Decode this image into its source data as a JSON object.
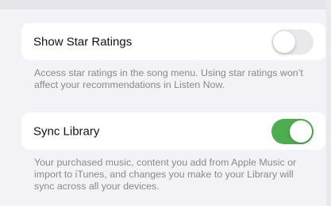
{
  "settings": {
    "star_ratings": {
      "label": "Show Star Ratings",
      "enabled": false,
      "footer": "Access star ratings in the song menu. Using star ratings won’t affect your recommendations in Listen Now."
    },
    "sync_library": {
      "label": "Sync Library",
      "enabled": true,
      "footer": "Your purchased music, content you add from Apple Music or import to iTunes, and changes you make to your Library will sync across all your devices."
    }
  },
  "colors": {
    "toggle_on": "#4cae4f",
    "toggle_off": "#e9e9eb",
    "background": "#f2f2f7",
    "footer_text": "#8a8a8e"
  }
}
